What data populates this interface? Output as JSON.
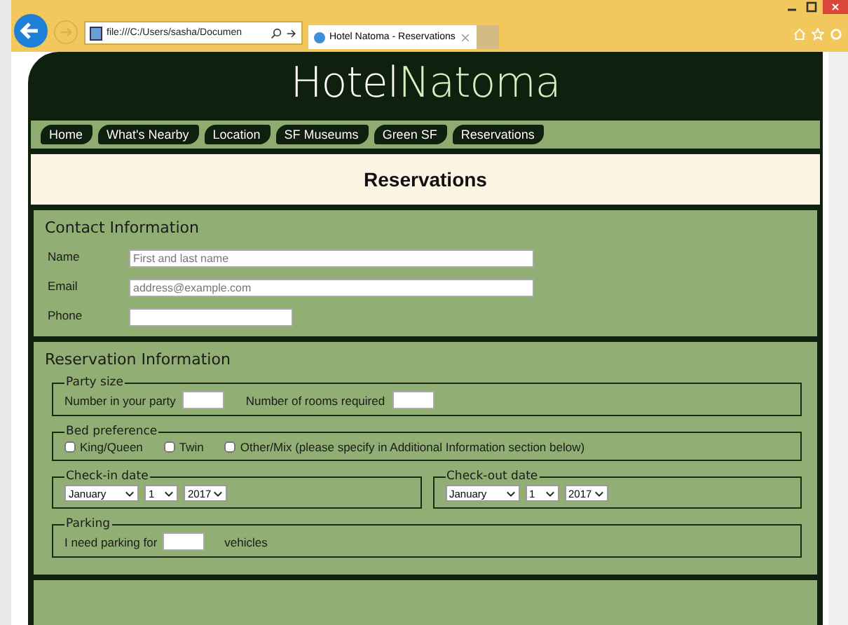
{
  "browser": {
    "address": "file:///C:/Users/sasha/Documen",
    "tab_title": "Hotel Natoma - Reservations"
  },
  "site_title": [
    "Hotel",
    "Natoma"
  ],
  "nav": [
    {
      "label": "Home"
    },
    {
      "label": "What's Nearby"
    },
    {
      "label": "Location"
    },
    {
      "label": "SF Museums"
    },
    {
      "label": "Green SF"
    },
    {
      "label": "Reservations"
    }
  ],
  "page_heading": "Reservations",
  "contact": {
    "heading": "Contact Information",
    "fields": [
      {
        "label": "Name",
        "placeholder": "First and last name",
        "kind": "wide"
      },
      {
        "label": "Email",
        "placeholder": "address@example.com",
        "kind": "wide"
      },
      {
        "label": "Phone",
        "kind": "narrow"
      }
    ]
  },
  "reservation": {
    "heading": "Reservation Information",
    "party": {
      "legend": "Party size",
      "fields": [
        {
          "label": "Number in your party"
        },
        {
          "label": "Number of rooms required"
        }
      ]
    },
    "bed": {
      "legend": "Bed preference",
      "options": [
        {
          "label": "King/Queen",
          "checked": false
        },
        {
          "label": "Twin",
          "checked": false
        },
        {
          "label": "Other/Mix (please specify in Additional Information section below)",
          "checked": false
        }
      ]
    },
    "dates": [
      {
        "legend": "Check-in date",
        "month": "January",
        "day": "1",
        "year": "2017"
      },
      {
        "legend": "Check-out date",
        "month": "January",
        "day": "1",
        "year": "2017"
      }
    ],
    "parking": {
      "legend": "Parking",
      "before": "I need parking for",
      "after": "vehicles"
    }
  }
}
